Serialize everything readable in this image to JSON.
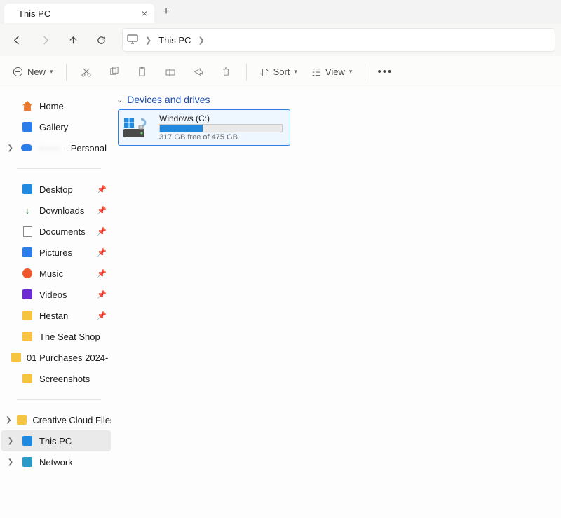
{
  "tab": {
    "title": "This PC"
  },
  "breadcrumb": {
    "current": "This PC"
  },
  "toolbar": {
    "new": "New",
    "sort": "Sort",
    "view": "View"
  },
  "sidebar": {
    "top": [
      {
        "label": "Home"
      },
      {
        "label": "Gallery"
      },
      {
        "label_prefix": "·······",
        "label_suffix": " - Personal",
        "expandable": true
      }
    ],
    "quick": [
      {
        "label": "Desktop",
        "pinned": true
      },
      {
        "label": "Downloads",
        "pinned": true
      },
      {
        "label": "Documents",
        "pinned": true
      },
      {
        "label": "Pictures",
        "pinned": true
      },
      {
        "label": "Music",
        "pinned": true
      },
      {
        "label": "Videos",
        "pinned": true
      },
      {
        "label": "Hestan",
        "pinned": true
      },
      {
        "label": "The Seat Shop",
        "pinned": false
      },
      {
        "label": "01 Purchases 2024-",
        "pinned": false
      },
      {
        "label": "Screenshots",
        "pinned": false
      }
    ],
    "bottom": [
      {
        "label": "Creative Cloud Files",
        "expandable": true
      },
      {
        "label": "This PC",
        "expandable": true,
        "selected": true
      },
      {
        "label": "Network",
        "expandable": true
      }
    ]
  },
  "section": {
    "header": "Devices and drives"
  },
  "drive": {
    "name": "Windows (C:)",
    "free_text": "317 GB free of 475 GB",
    "used_pct": 35
  }
}
